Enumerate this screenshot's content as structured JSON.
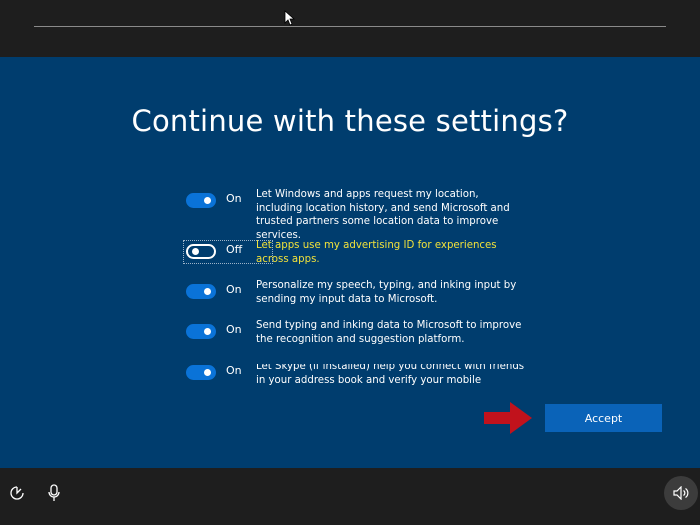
{
  "title": "Continue with these settings?",
  "settings": [
    {
      "state": "On",
      "enabled": true,
      "text": "Let Windows and apps request my location, including location history, and send Microsoft and trusted partners some location data to improve services."
    },
    {
      "state": "Off",
      "enabled": false,
      "text": "Let apps use my advertising ID for experiences across apps."
    },
    {
      "state": "On",
      "enabled": true,
      "text": "Personalize my speech, typing, and inking input by sending my input data to Microsoft."
    },
    {
      "state": "On",
      "enabled": true,
      "text": "Send typing and inking data to Microsoft to improve the recognition and suggestion platform."
    },
    {
      "state": "On",
      "enabled": true,
      "text": "Let Skype (if installed) help you connect with friends in your address book and verify your mobile number. SMS"
    }
  ],
  "accept_label": "Accept",
  "icons": {
    "cursor": "mouse-pointer-icon",
    "arrow": "red-arrow-icon",
    "ease_of_access": "ease-of-access-icon",
    "microphone": "microphone-icon",
    "volume": "volume-icon"
  },
  "colors": {
    "background": "#003d6e",
    "bar": "#1e1e1e",
    "accent": "#0a73d8",
    "button": "#0a63b8",
    "highlight_text": "#f2e23a",
    "arrow": "#c1121c"
  }
}
